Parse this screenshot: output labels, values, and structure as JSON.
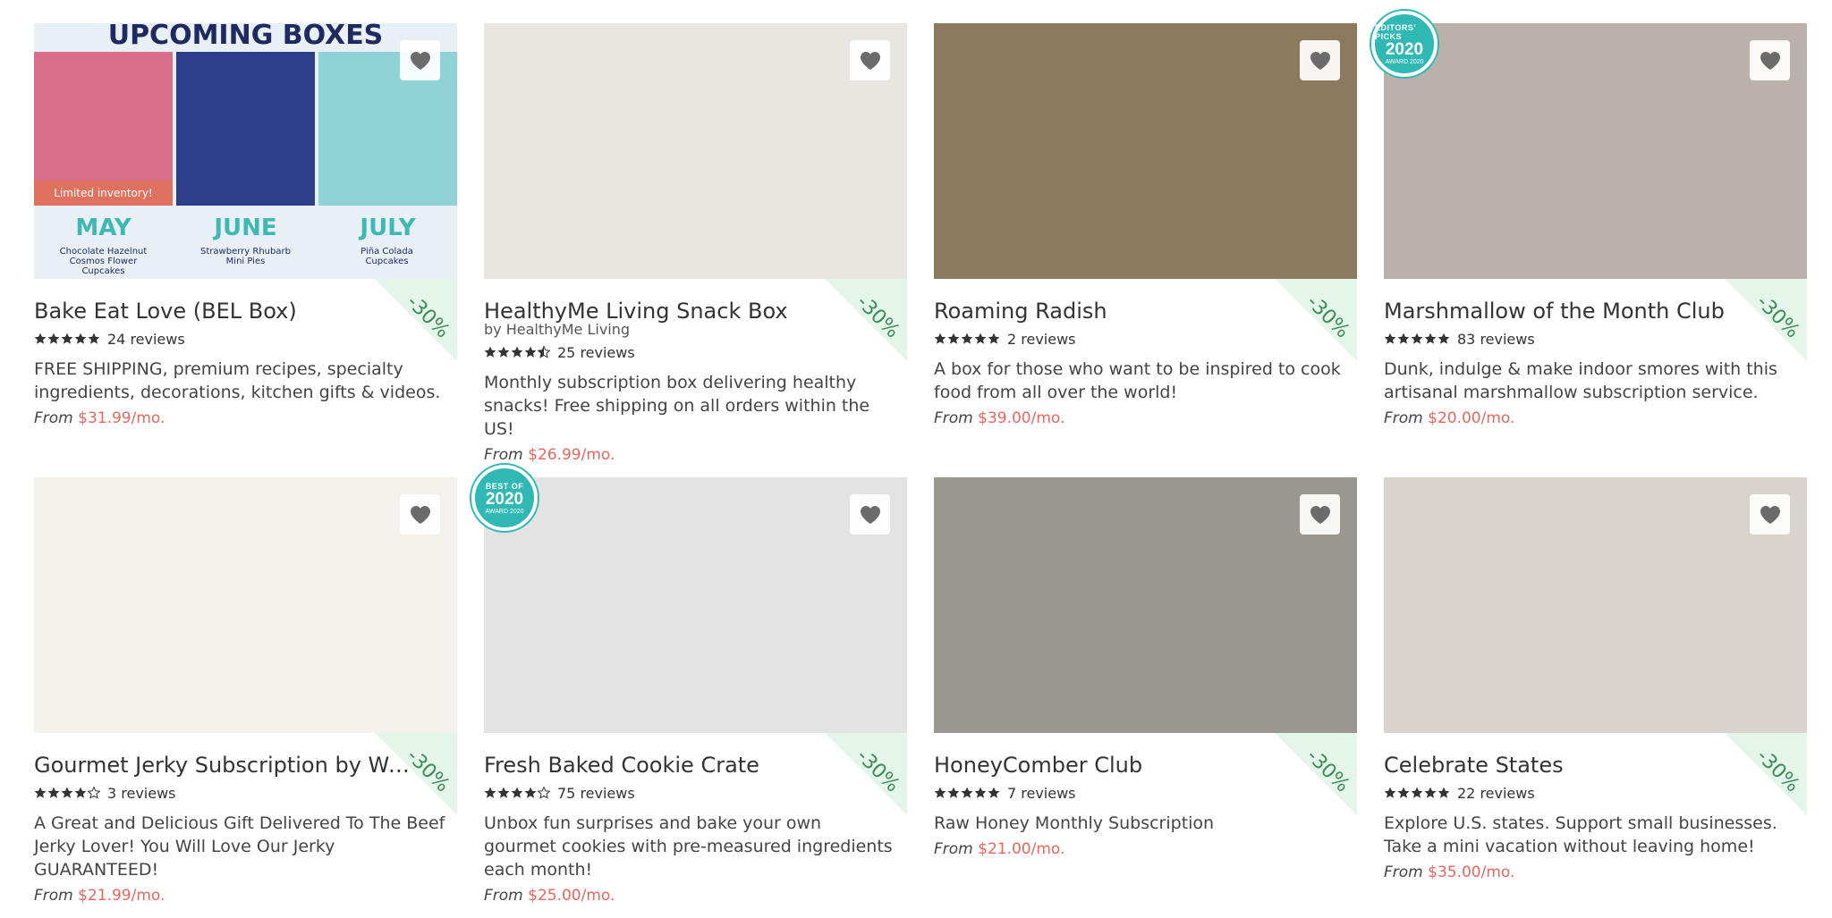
{
  "labels": {
    "from": "From",
    "discount": "-30%"
  },
  "colors": {
    "price": "#e8665e",
    "ribbon_bg": "#e4f6ea",
    "ribbon_text": "#3c8a58",
    "badge": "#2fb8b4"
  },
  "products": [
    {
      "title": "Bake Eat Love (BEL Box)",
      "byline": "",
      "rating": 5,
      "reviews": "24 reviews",
      "description": "FREE SHIPPING, premium recipes, specialty ingredients, decorations, kitchen gifts & videos.",
      "price": "$31.99/mo.",
      "image_color": "#c9dbe8",
      "image_text": [
        "UPCOMING BOXES",
        "MAY",
        "JUNE",
        "JULY",
        "Limited inventory!",
        "Chocolate Hazelnut Cosmos Flower Cupcakes",
        "Strawberry Rhubarb Mini Pies",
        "Piña Colada Cupcakes"
      ],
      "badge": null
    },
    {
      "title": "HealthyMe Living Snack Box",
      "byline": "by HealthyMe Living",
      "rating": 4.5,
      "reviews": "25 reviews",
      "description": "Monthly subscription box delivering healthy snacks! Free shipping on all orders within the US!",
      "price": "$26.99/mo.",
      "image_color": "#e9e6e1",
      "badge": null
    },
    {
      "title": "Roaming Radish",
      "byline": "",
      "rating": 5,
      "reviews": "2 reviews",
      "description": "A box for those who want to be inspired to cook food from all over the world!",
      "price": "$39.00/mo.",
      "image_color": "#8c7a5e",
      "badge": null
    },
    {
      "title": "Marshmallow of the Month Club",
      "byline": "",
      "rating": 5,
      "reviews": "83 reviews",
      "description": "Dunk, indulge & make indoor smores with this artisanal marshmallow subscription service.",
      "price": "$20.00/mo.",
      "image_color": "#b9b2aa",
      "badge": {
        "top": "EDITORS' PICKS",
        "year": "2020",
        "bottom": "AWARD 2020"
      }
    },
    {
      "title": "Gourmet Jerky Subscription by Woo...",
      "byline": "",
      "rating": 4,
      "reviews": "3 reviews",
      "description": "A Great and Delicious Gift Delivered To The Beef Jerky Lover! You Will Love Our Jerky GUARANTEED!",
      "price": "$21.99/mo.",
      "image_color": "#f4f0ec",
      "badge": null
    },
    {
      "title": "Fresh Baked Cookie Crate",
      "byline": "",
      "rating": 4,
      "reviews": "75 reviews",
      "description": "Unbox fun surprises and bake your own gourmet cookies with pre-measured ingredients each month!",
      "price": "$25.00/mo.",
      "image_color": "#e3e3e3",
      "badge": {
        "top": "BEST OF",
        "year": "2020",
        "bottom": "AWARD 2020"
      }
    },
    {
      "title": "HoneyComber Club",
      "byline": "",
      "rating": 5,
      "reviews": "7 reviews",
      "description": "Raw Honey Monthly Subscription",
      "price": "$21.00/mo.",
      "image_color": "#9a9791",
      "badge": null
    },
    {
      "title": "Celebrate States",
      "byline": "",
      "rating": 5,
      "reviews": "22 reviews",
      "description": "Explore U.S. states. Support small businesses. Take a mini vacation without leaving home!",
      "price": "$35.00/mo.",
      "image_color": "#d8d4cd",
      "badge": null
    }
  ]
}
